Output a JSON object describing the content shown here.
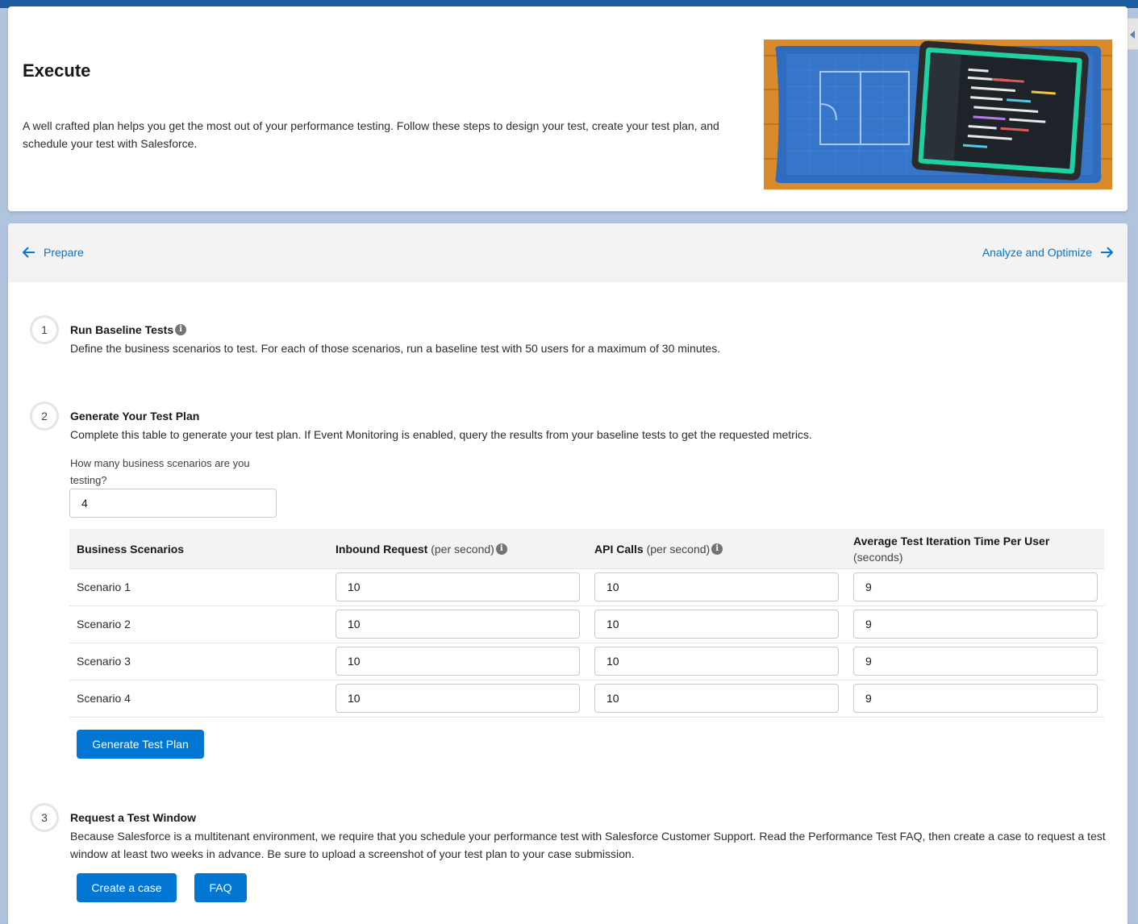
{
  "header": {
    "title": "Execute",
    "description": "A well crafted plan helps you get the most out of your performance testing. Follow these steps to design your test, create your test plan, and schedule your test with Salesforce."
  },
  "nav": {
    "prev_label": "Prepare",
    "next_label": "Analyze and Optimize"
  },
  "steps": [
    {
      "number": "1",
      "title": "Run Baseline Tests",
      "description": "Define the business scenarios to test. For each of those scenarios, run a baseline test with 50 users for a maximum of 30 minutes."
    },
    {
      "number": "2",
      "title": "Generate Your Test Plan",
      "description": "Complete this table to generate your test plan. If Event Monitoring is enabled, query the results from your baseline tests to get the requested metrics."
    },
    {
      "number": "3",
      "title": "Request a Test Window",
      "description": "Because Salesforce is a multitenant environment, we require that you schedule your performance test with Salesforce Customer Support. Read the Performance Test FAQ, then create a case to request a test window at least two weeks in advance. Be sure to upload a screenshot of your test plan to your case submission."
    }
  ],
  "scenario_count": {
    "label": "How many business scenarios are you testing?",
    "value": "4"
  },
  "table": {
    "headers": {
      "scenarios": "Business Scenarios",
      "inbound": "Inbound Request",
      "inbound_unit": "(per second)",
      "api": "API Calls",
      "api_unit": "(per second)",
      "avg": "Average Test Iteration Time Per User",
      "avg_unit": "(seconds)"
    },
    "rows": [
      {
        "name": "Scenario 1",
        "inbound": "10",
        "api": "10",
        "avg": "9"
      },
      {
        "name": "Scenario 2",
        "inbound": "10",
        "api": "10",
        "avg": "9"
      },
      {
        "name": "Scenario 3",
        "inbound": "10",
        "api": "10",
        "avg": "9"
      },
      {
        "name": "Scenario 4",
        "inbound": "10",
        "api": "10",
        "avg": "9"
      }
    ]
  },
  "buttons": {
    "generate": "Generate Test Plan",
    "create_case": "Create a case",
    "faq": "FAQ"
  },
  "icons": {
    "info": "info-icon",
    "prev": "arrow-left-icon",
    "next": "arrow-right-icon"
  },
  "colors": {
    "brand": "#0176d3",
    "background": "#b0c4de"
  }
}
